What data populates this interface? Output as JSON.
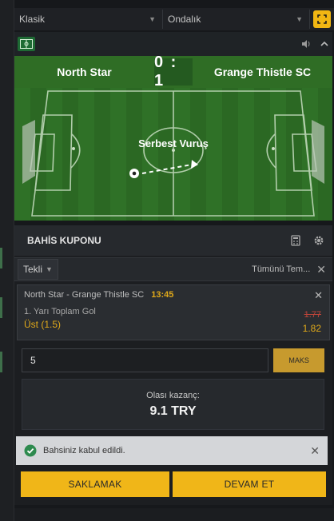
{
  "topbar": {
    "format_select": "Klasik",
    "odds_select": "Ondalık",
    "expand_icon": "expand-icon"
  },
  "pitch": {
    "home_team": "North Star",
    "score": "0 : 1",
    "away_team": "Grange Thistle SC",
    "event": "Serbest Vuruş",
    "icons": [
      "field-icon",
      "volume-icon",
      "chevron-up-icon"
    ]
  },
  "coupon": {
    "title": "BAHİS KUPONU",
    "tab": "Tekli",
    "remove_all": "Tümünü Tem...",
    "bet": {
      "match": "North Star - Grange Thistle SC",
      "time": "13:45",
      "market": "1. Yarı Toplam Gol",
      "pick": "Üst (1.5)",
      "old_odds": "1.77",
      "odds": "1.82"
    },
    "stake": "5",
    "max_label": "MAKS",
    "win_label": "Olası kazanç:",
    "win_value": "9.1 TRY",
    "toast": "Bahsiniz kabul edildi.",
    "save_btn": "SAKLAMAK",
    "continue_btn": "DEVAM ET"
  },
  "colors": {
    "accent": "#f0b618",
    "pitch": "#2d6b25",
    "odds_down": "#c0453a"
  }
}
